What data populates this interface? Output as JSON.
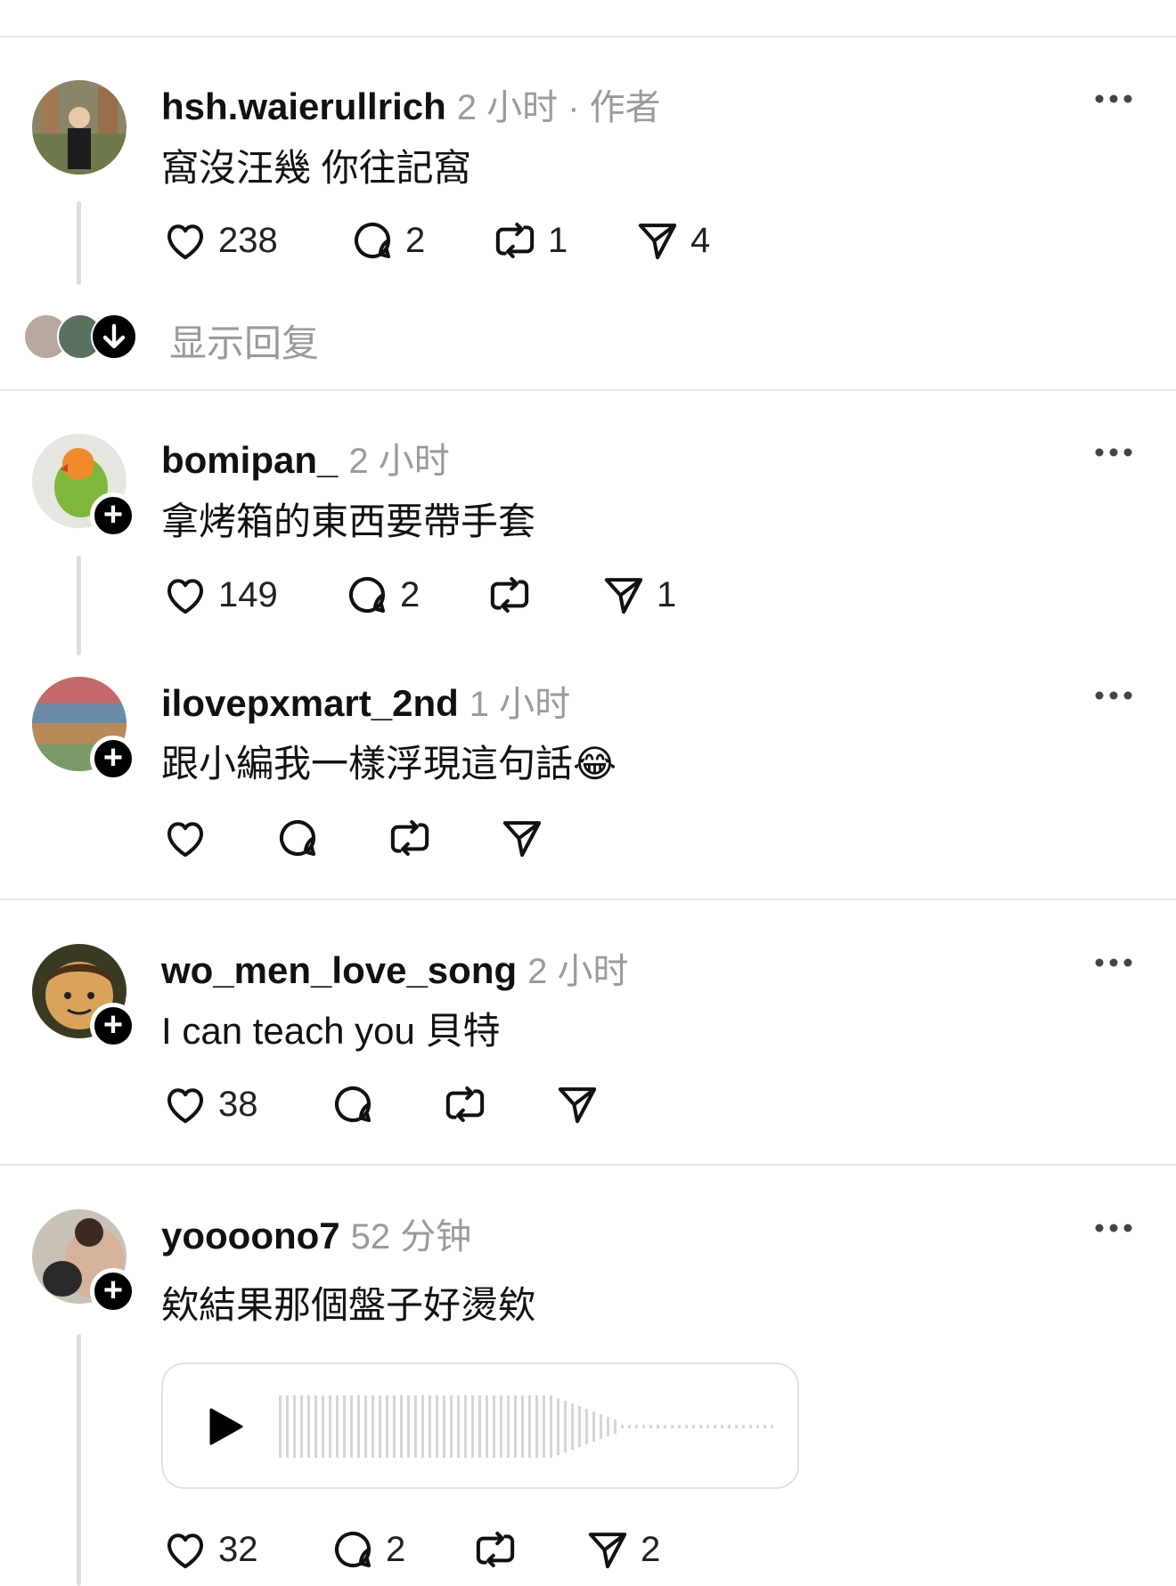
{
  "posts": [
    {
      "username": "hsh.waierullrich",
      "meta": "2 小时 · 作者",
      "text": "窩沒汪幾 你往記窩",
      "likes": "238",
      "comments": "2",
      "reposts": "1",
      "shares": "4"
    },
    {
      "username": "bomipan_",
      "meta": "2 小时",
      "text": "拿烤箱的東西要帶手套",
      "likes": "149",
      "comments": "2",
      "reposts": "",
      "shares": "1"
    },
    {
      "username": "ilovepxmart_2nd",
      "meta": "1 小时",
      "text": "跟小編我一樣浮現這句話😂",
      "likes": "",
      "comments": "",
      "reposts": "",
      "shares": ""
    },
    {
      "username": "wo_men_love_song",
      "meta": "2 小时",
      "text": "I can teach you 貝特",
      "likes": "38",
      "comments": "",
      "reposts": "",
      "shares": ""
    },
    {
      "username": "yoooono7",
      "meta": "52 分钟",
      "text": "欸結果那個盤子好燙欸",
      "likes": "32",
      "comments": "2",
      "reposts": "",
      "shares": "2"
    }
  ],
  "show_replies_label": "显示回复",
  "icons": {
    "like": "heart-icon",
    "comment": "comment-bubble-icon",
    "repost": "repost-icon",
    "share": "send-icon",
    "more": "more-dots-icon",
    "play": "play-icon",
    "follow": "plus-icon"
  }
}
